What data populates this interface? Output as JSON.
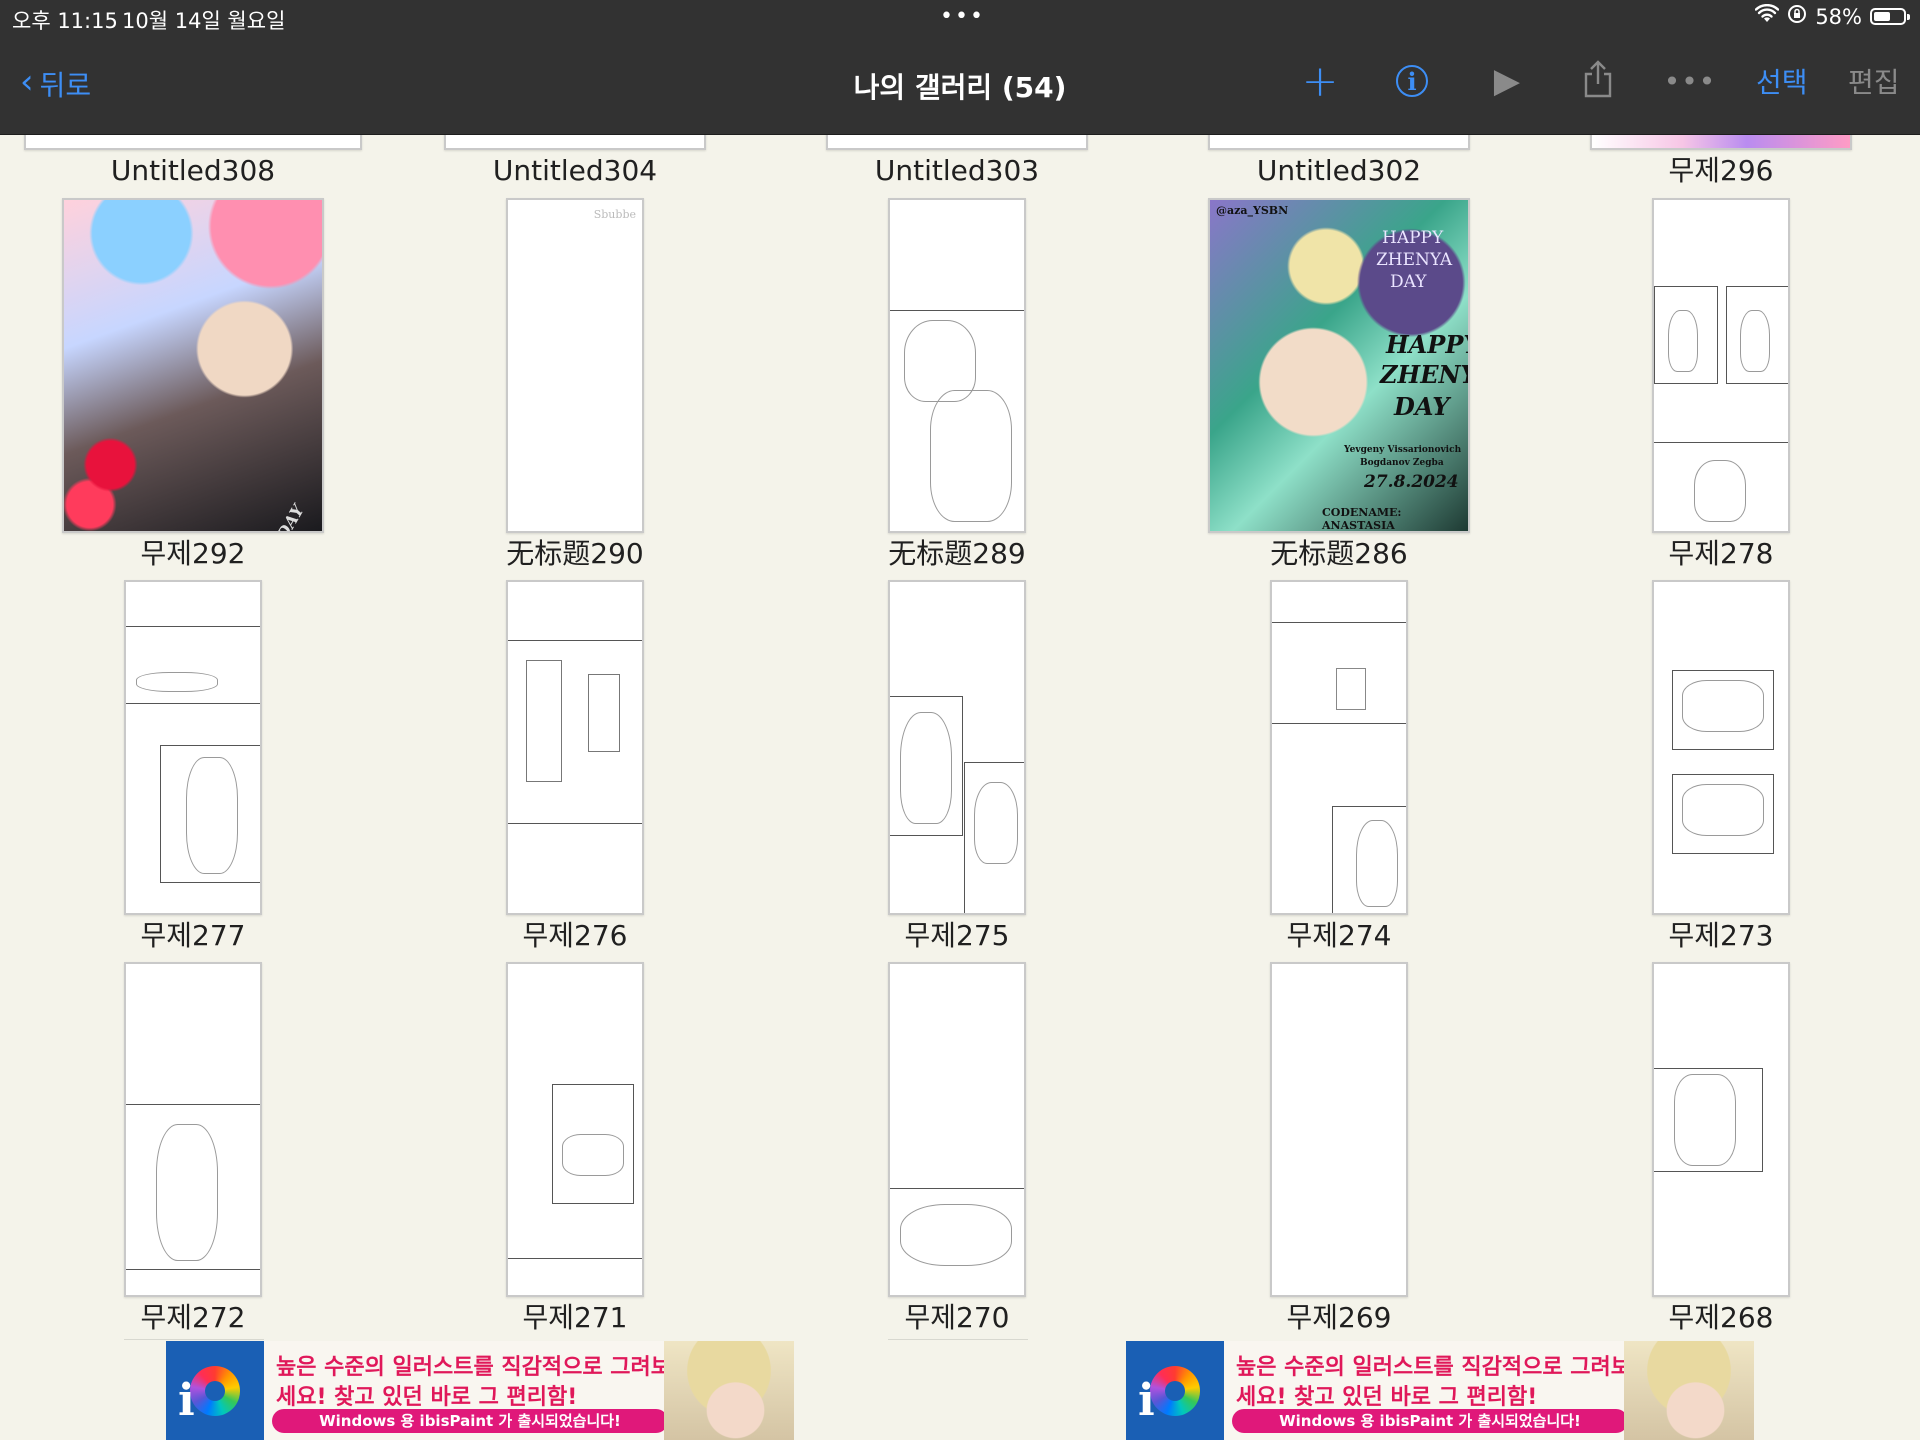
{
  "status_bar": {
    "time": "오후 11:15",
    "date": "10월 14일 월요일",
    "battery": "58%",
    "battery_level": 0.58,
    "multitask_dots": "•••",
    "icons": [
      "wifi-icon",
      "orientation-lock-icon",
      "battery-icon"
    ]
  },
  "nav": {
    "back_label": "뒤로",
    "back_chevron": "‹",
    "title": "나의 갤러리 (54)",
    "add_symbol": "+",
    "info_symbol": "i",
    "play_symbol": "▶",
    "more_symbol": "•••",
    "select_label": "선택",
    "edit_label": "편집",
    "icons": [
      "plus-icon",
      "info-icon",
      "play-icon",
      "share-icon",
      "more-icon"
    ]
  },
  "colors": {
    "accent": "#3d8ef5",
    "nav_bg": "#323232",
    "gallery_bg": "#f4f3ea",
    "ad_pink": "#e0185a"
  },
  "gallery": {
    "artworks": [
      {
        "title": "Untitled308"
      },
      {
        "title": "Untitled304"
      },
      {
        "title": "Untitled303"
      },
      {
        "title": "Untitled302"
      },
      {
        "title": "무제296"
      },
      {
        "title": "무제292",
        "text": "HAPPY ... DAY"
      },
      {
        "title": "无标题290",
        "text": "Sbubbe"
      },
      {
        "title": "无标题289"
      },
      {
        "title": "无标题286",
        "text_lines": [
          "@aza_YSBN",
          "HAPPY",
          "ZHENYA",
          "DAY",
          "HAPPY",
          "ZHENYA",
          "DAY",
          "Yevgeny Vissarionovich",
          "Bogdanov Zegba",
          "27.8.2024",
          "CODENAME: ANASTASIA"
        ]
      },
      {
        "title": "무제278"
      },
      {
        "title": "무제277"
      },
      {
        "title": "무제276"
      },
      {
        "title": "무제275"
      },
      {
        "title": "무제274"
      },
      {
        "title": "무제273"
      },
      {
        "title": "무제272"
      },
      {
        "title": "무제271"
      },
      {
        "title": "무제270"
      },
      {
        "title": "무제269"
      },
      {
        "title": "무제268"
      }
    ]
  },
  "ads": [
    {
      "line1": "높은 수준의 일러스트를 직감적으로 그려보",
      "line2": "세요! 찾고 있던 바로 그 편리함!",
      "button": "Windows 용 ibisPaint 가 출시되었습니다!",
      "logo_letter": "i"
    },
    {
      "line1": "높은 수준의 일러스트를 직감적으로 그려보",
      "line2": "세요! 찾고 있던 바로 그 편리함!",
      "button": "Windows 용 ibisPaint 가 출시되었습니다!",
      "logo_letter": "i"
    }
  ]
}
